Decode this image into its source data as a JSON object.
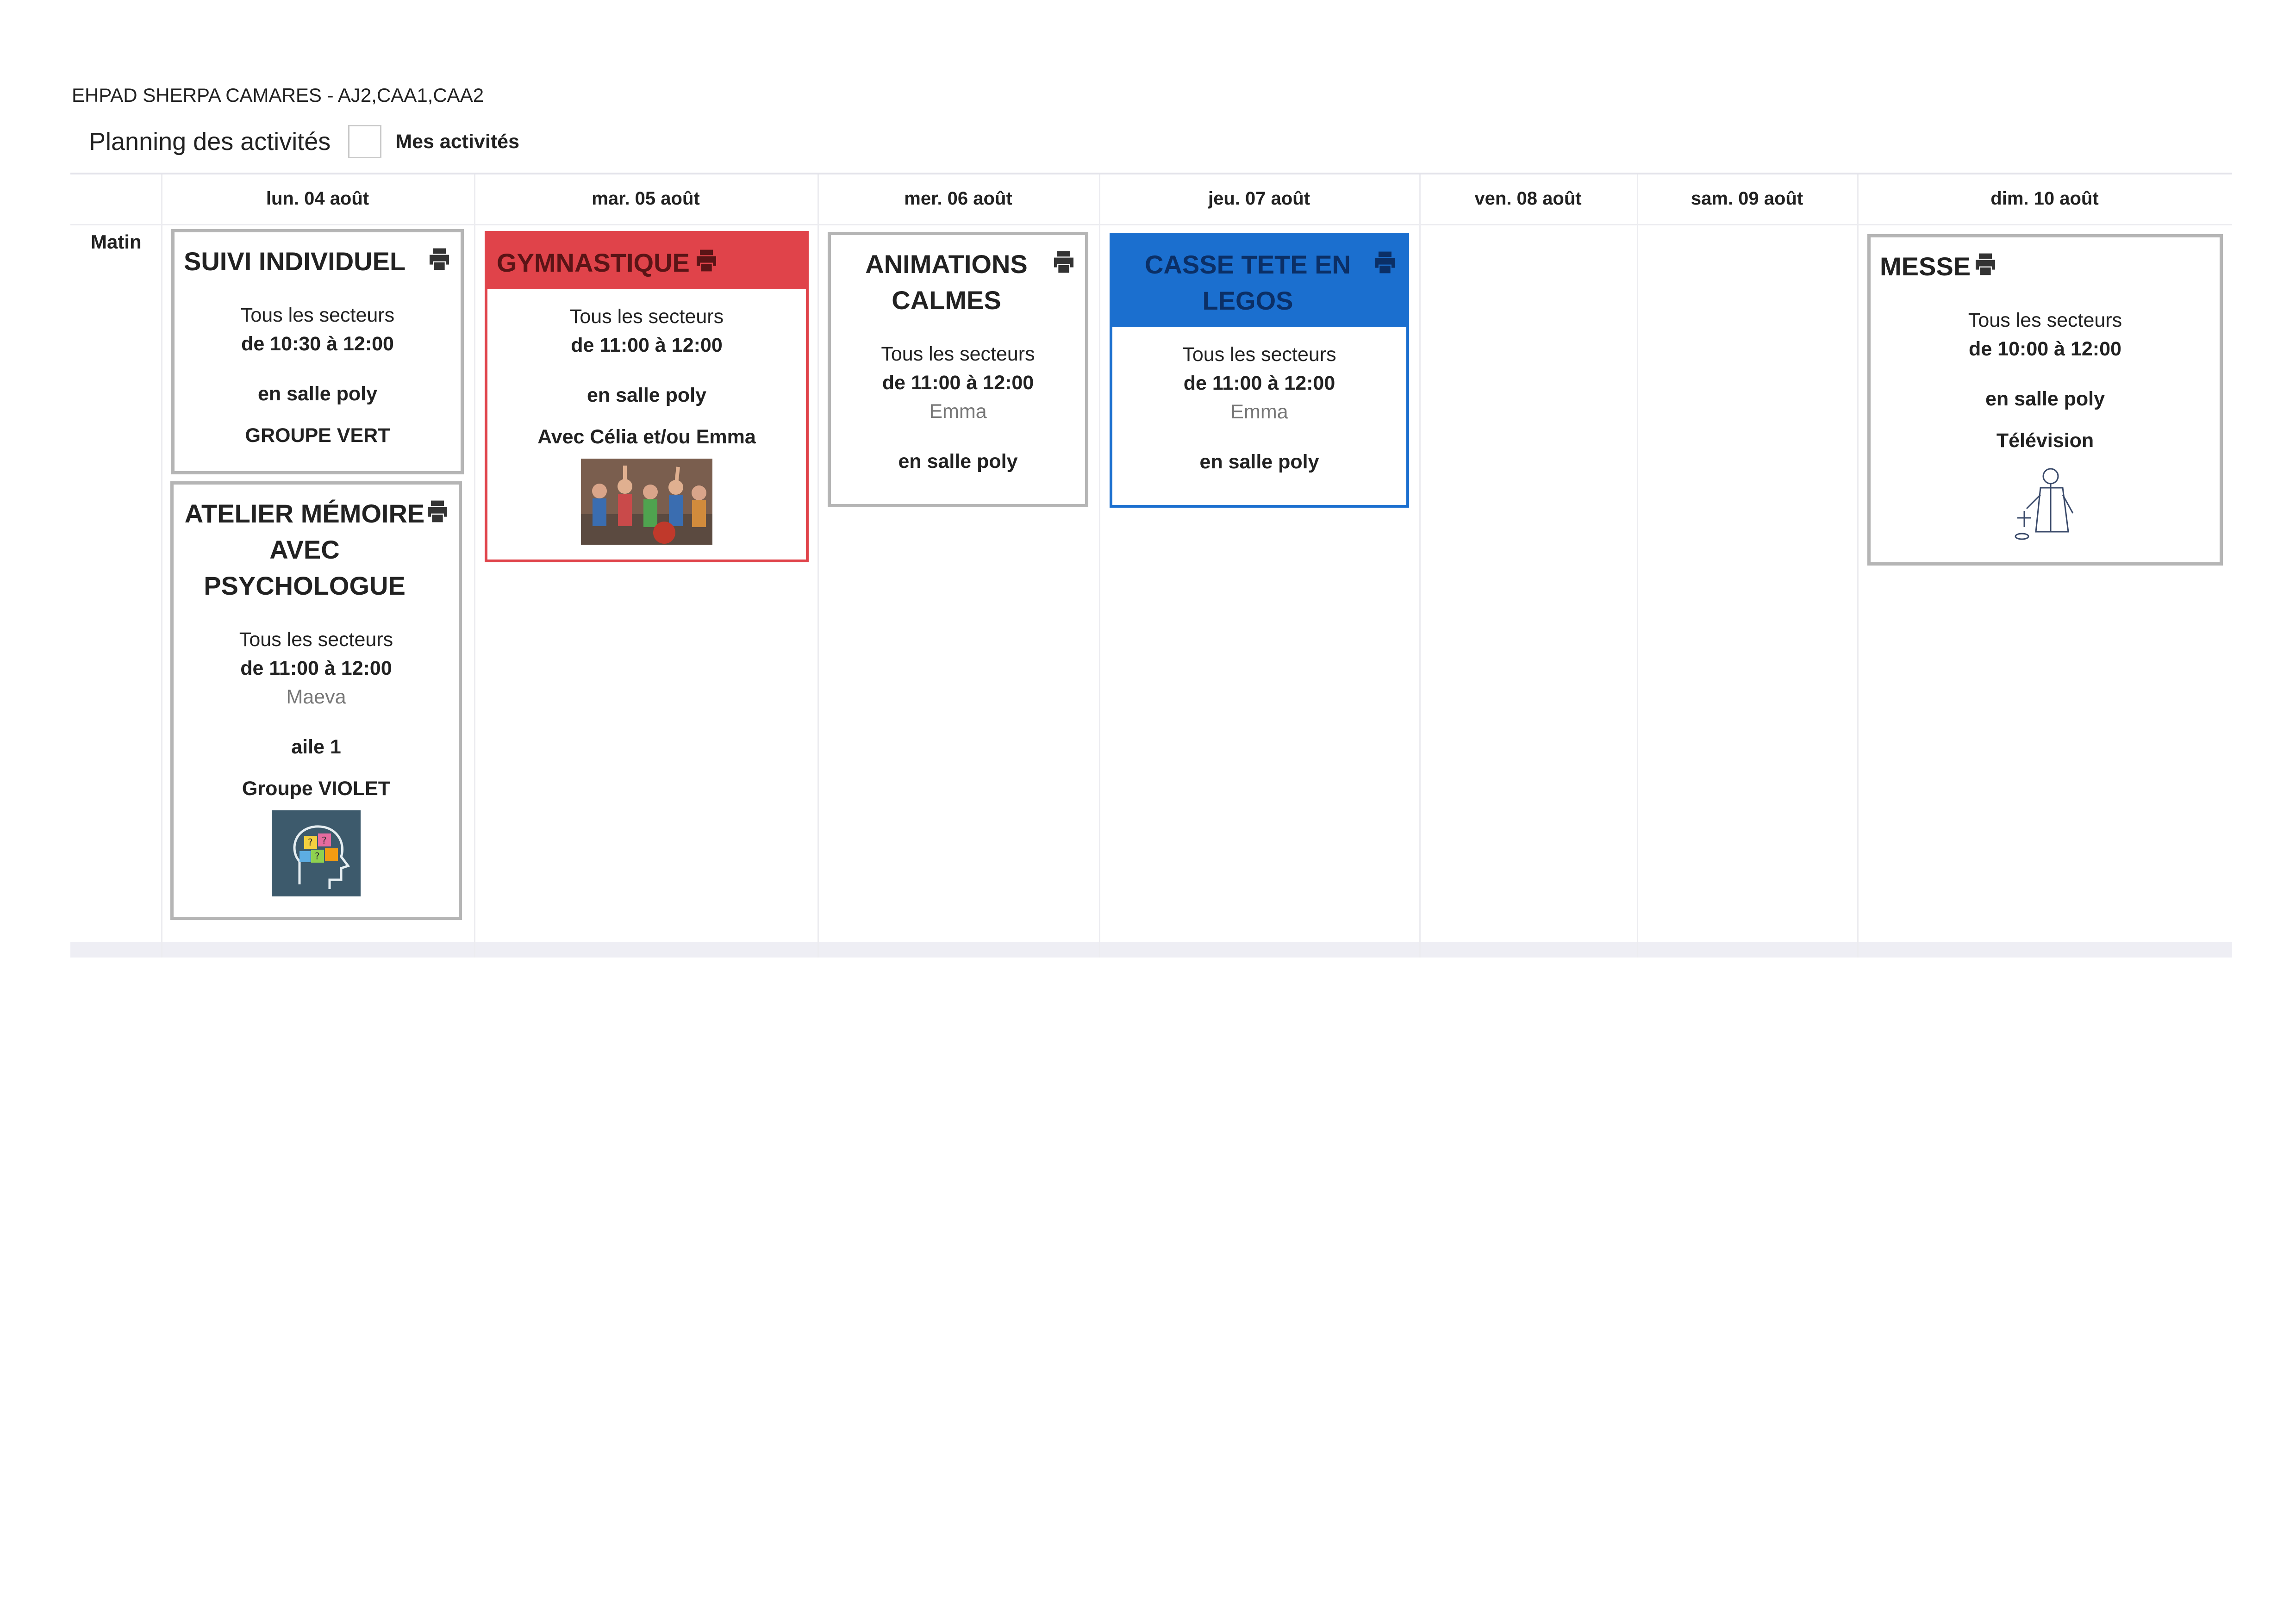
{
  "header": {
    "site": "EHPAD SHERPA CAMARES - AJ2,CAA1,CAA2",
    "title": "Planning des activités",
    "filter_label": "Mes activités"
  },
  "grid": {
    "row_label": "Matin",
    "days": [
      "lun. 04 août",
      "mar. 05 août",
      "mer. 06 août",
      "jeu. 07 août",
      "ven. 08 août",
      "sam. 09 août",
      "dim. 10 août"
    ]
  },
  "activities": [
    {
      "title": "SUIVI INDIVIDUEL",
      "sector": "Tous les secteurs",
      "time": "de 10:30 à 12:00",
      "place": "en salle poly",
      "note": "GROUPE VERT"
    },
    {
      "title": "ATELIER MÉMOIRE AVEC PSYCHOLOGUE",
      "sector": "Tous les secteurs",
      "time": "de 11:00 à 12:00",
      "person": "Maeva",
      "place": "aile 1",
      "note": "Groupe VIOLET",
      "image": "brain-question-image"
    },
    {
      "title": "GYMNASTIQUE",
      "sector": "Tous les secteurs",
      "time": "de 11:00 à 12:00",
      "place": "en salle poly",
      "note": "Avec Célia et/ou Emma",
      "image": "gym-class-photo",
      "color": "#e0434a"
    },
    {
      "title": "ANIMATIONS CALMES",
      "sector": "Tous les secteurs",
      "time": "de 11:00 à 12:00",
      "person": "Emma",
      "place": "en salle poly"
    },
    {
      "title": "CASSE TETE EN LEGOS",
      "sector": "Tous les secteurs",
      "time": "de 11:00 à 12:00",
      "person": "Emma",
      "place": "en salle poly",
      "color": "#1b6fcf"
    },
    {
      "title": "MESSE",
      "sector": "Tous les secteurs",
      "time": "de 10:00 à 12:00",
      "place": "en salle poly",
      "note": "Télévision",
      "image": "priest-drawing"
    }
  ],
  "icons": {
    "print": "printer-icon"
  }
}
